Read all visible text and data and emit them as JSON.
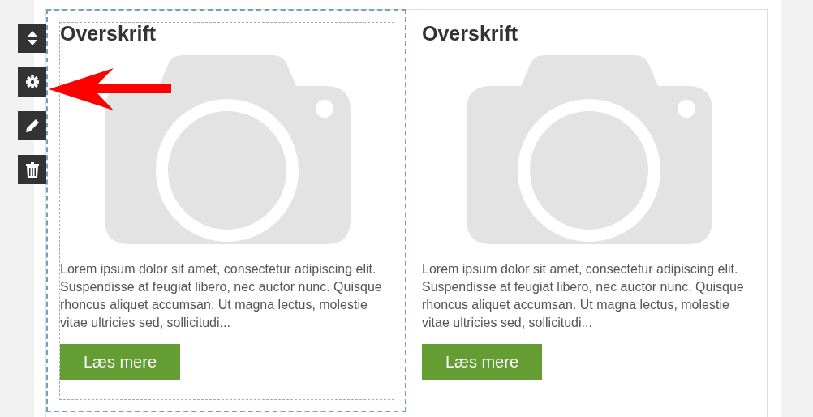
{
  "toolbar": [
    {
      "kind": "move"
    },
    {
      "kind": "settings"
    },
    {
      "kind": "edit"
    },
    {
      "kind": "delete"
    }
  ],
  "columns": [
    {
      "selected": true,
      "heading": "Overskrift",
      "image": {
        "kind": "placeholder"
      },
      "text": "Lorem ipsum dolor sit amet, consectetur adipiscing elit. Suspendisse at feugiat libero, nec auctor nunc. Quisque rhoncus aliquet accumsan. Ut magna lectus, molestie vitae ultricies sed, sollicitudi...",
      "button": "Læs mere"
    },
    {
      "selected": false,
      "heading": "Overskrift",
      "image": {
        "kind": "placeholder"
      },
      "text": "Lorem ipsum dolor sit amet, consectetur adipiscing elit. Suspendisse at feugiat libero, nec auctor nunc. Quisque rhoncus aliquet accumsan. Ut magna lectus, molestie vitae ultricies sed, sollicitudi...",
      "button": "Læs mere"
    }
  ]
}
